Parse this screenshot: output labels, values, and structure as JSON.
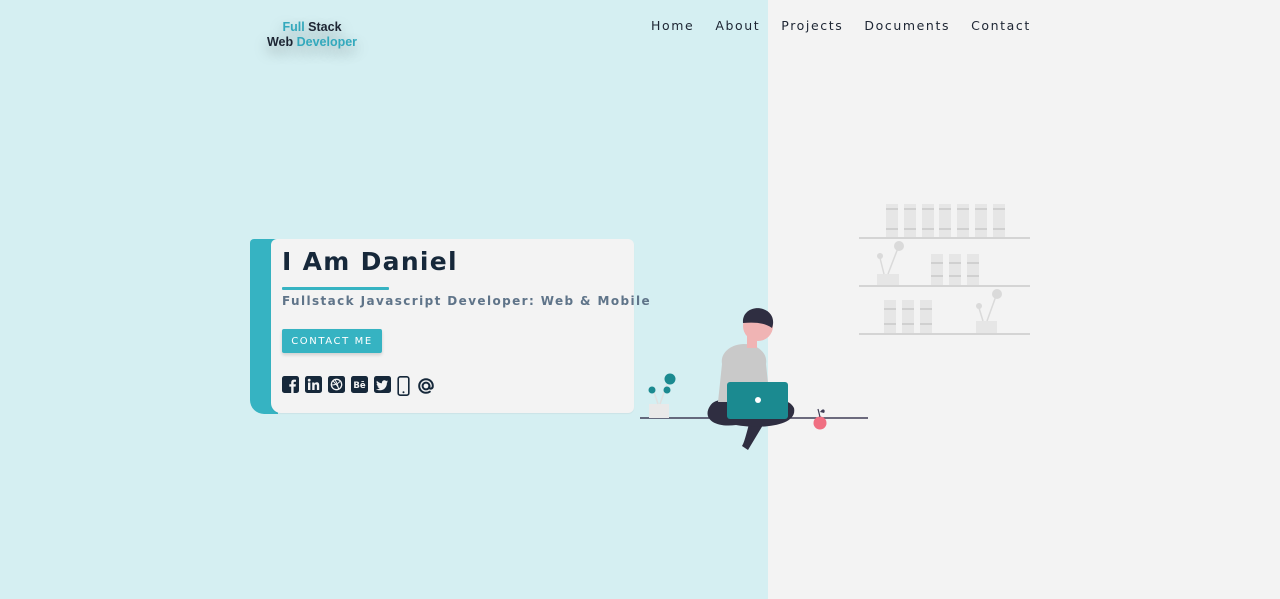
{
  "logo": {
    "line1_accent": "Full",
    "line1_dark": "Stack",
    "line2_dark": "Web",
    "line2_accent": "Developer"
  },
  "nav": {
    "items": [
      "Home",
      "About",
      "Projects",
      "Documents",
      "Contact"
    ]
  },
  "hero": {
    "heading": "I Am Daniel",
    "subtitle": "Fullstack Javascript Developer: Web & Mobile",
    "contact_label": "CONTACT ME",
    "social_icons": [
      "facebook-icon",
      "linkedin-icon",
      "dribbble-icon",
      "behance-icon",
      "twitter-icon",
      "mobile-phone-icon",
      "email-at-icon"
    ]
  },
  "colors": {
    "accent": "#36b3c2",
    "left_bg": "#d5eff2",
    "right_bg": "#f3f3f3",
    "heading": "#16283a",
    "subtitle": "#5f7489"
  }
}
